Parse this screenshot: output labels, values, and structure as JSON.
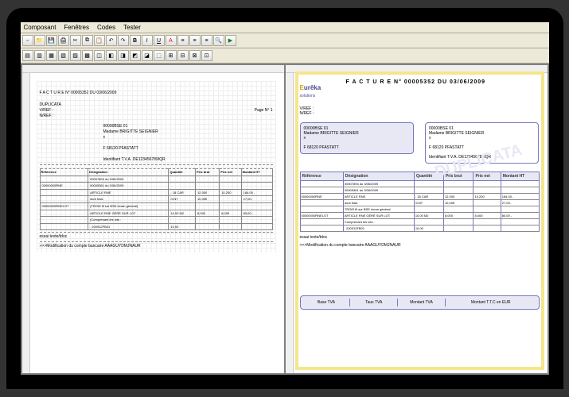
{
  "menu": {
    "m1": "Composant",
    "m2": "Fenêtres",
    "m3": "Codes",
    "m4": "Tester"
  },
  "left": {
    "title": "F A C T U R E N° 00005352 DU 03/06/2009",
    "dup": "DUPLICATA",
    "vref": "V/REF :",
    "nref": "N/REF :",
    "page": "Page N° 1",
    "client_code": "00000BSE 01",
    "client_name": "Madame BRIGITTE SEIGNIER",
    "client_x": "x",
    "client_city": "F 68120 PFASTATT",
    "tva": "Identifiant T.V.A. DE123456789IQR",
    "cols": {
      "ref": "Référence",
      "des": "Désignation",
      "qte": "Quantité",
      "pb": "Prix brut",
      "pn": "Prix net",
      "mt": "Montant HT"
    },
    "lines": [
      {
        "ref": "",
        "des": "00007894 du 3/06/2009",
        "q": "",
        "pb": "",
        "pn": "",
        "mt": ""
      },
      {
        "ref": "00000000RNE",
        "des": "00005361 du 3/06/2009",
        "q": "",
        "pb": "",
        "pn": "",
        "mt": ""
      },
      {
        "ref": "",
        "des": "ARTICLE RNE",
        "q": "- 18 CAR",
        "pb": "12,000",
        "pn": "10,200",
        "mt": "184,00 -"
      },
      {
        "ref": "",
        "des": "dont frais",
        "q": "/CNT",
        "pb": "10,00€",
        "pn": "",
        "mt": "27,00-"
      },
      {
        "ref": "00000000RNELOT",
        "des": "(TROIS fil sur BSE écran général)",
        "q": "",
        "pb": "",
        "pn": "",
        "mt": ""
      },
      {
        "ref": "",
        "des": "ARTICLE RNE GÉRÉ SUR LOT",
        "q": "10,00 M2",
        "pb": "8,000",
        "pn": "8,000",
        "mt": "80,00 -"
      },
      {
        "ref": "",
        "des": "(Comprenant les lots :",
        "q": "",
        "pb": "",
        "pn": "",
        "mt": ""
      },
      {
        "ref": "",
        "des": ". 200912FB01",
        "q": "10,00",
        "pb": "",
        "pn": "",
        "mt": ""
      }
    ],
    "essai": "essai texte/tdoc",
    "modif": ">>>Modification du compte bancaire AAAGUYDMJNAUR"
  },
  "right": {
    "brand": "Eurêka",
    "brand_sub": "solutions",
    "title": "F A C T U R E N° 00005352 DU 03/06/2009",
    "vref": "V/REF :",
    "nref": "N/REF :",
    "box1_code": "00000BSE 01",
    "box1_name": "Madame BRIGITTE SEIGNIER",
    "box1_x": "x",
    "box1_city": "F 68120 PFASTATT",
    "box2_code": "00000BSE 01",
    "box2_name": "Madame BRIGITTE SEIGNIER",
    "box2_x": "x",
    "box2_city": "F 68120 PFASTATT",
    "box2_tva": "Identifiant T.V.A. DE123456789IQR",
    "watermark": "DUPLICATA",
    "cols": {
      "ref": "Référence",
      "des": "Désignation",
      "qte": "Quantité",
      "pb": "Prix brut",
      "pn": "Prix net",
      "mt": "Montant HT"
    },
    "lines": [
      {
        "ref": "",
        "des": "00007894 du 3/06/2009",
        "q": "",
        "pb": "",
        "pn": "",
        "mt": ""
      },
      {
        "ref": "",
        "des": "00005361 du 3/06/2009",
        "q": "",
        "pb": "",
        "pn": "",
        "mt": ""
      },
      {
        "ref": "00000000RNE",
        "des": "ARTICLE RNE",
        "q": "- 18 CAR",
        "pb": "12,000",
        "pn": "10,200",
        "mt": "184,00 -"
      },
      {
        "ref": "",
        "des": "dont frais",
        "q": "/CNT",
        "pb": "10,00€",
        "pn": "",
        "mt": "27,00-"
      },
      {
        "ref": "",
        "des": "TROIS fil sur BSE écran général",
        "q": "",
        "pb": "",
        "pn": "",
        "mt": ""
      },
      {
        "ref": "00000000RNELOT",
        "des": "ARTICLE RNE GÉRÉ SUR LOT",
        "q": "10,00 M2",
        "pb": "8,000",
        "pn": "8,000",
        "mt": "80,00 -"
      },
      {
        "ref": "",
        "des": "Comprenant les lots :",
        "q": "",
        "pb": "",
        "pn": "",
        "mt": ""
      },
      {
        "ref": "",
        "des": ". 200912FB01",
        "q": "10,00",
        "pb": "",
        "pn": "",
        "mt": ""
      }
    ],
    "essai": "essai texte/tdoc",
    "modif": ">>>Modification du compte bancaire AAAGUYDMJNAUR",
    "footer": {
      "f1": "Base TVA",
      "f2": "Taux TVA",
      "f3": "Montant TVA",
      "f4": "Montant T.T.C en EUR"
    }
  }
}
